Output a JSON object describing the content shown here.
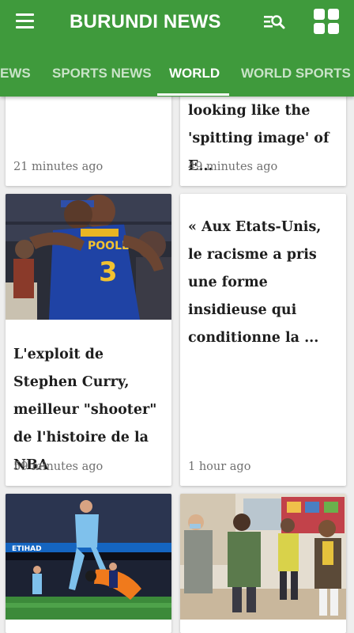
{
  "app": {
    "title": "BURUNDI NEWS",
    "theme_color": "#3f9a3c",
    "icons": {
      "menu": "hamburger-menu-icon",
      "search": "search-list-icon",
      "layout": "grid-view-icon"
    }
  },
  "tabs": [
    {
      "label": "EWS",
      "active": false
    },
    {
      "label": "SPORTS NEWS",
      "active": false
    },
    {
      "label": "WORLD",
      "active": true
    },
    {
      "label": "WORLD SPORTS",
      "active": false
    }
  ],
  "cards": [
    {
      "headline": "",
      "time": "21 minutes ago"
    },
    {
      "headline": "looking like the 'spitting image' of E...",
      "time": "49 minutes ago"
    },
    {
      "headline": "L'exploit de Stephen Curry, meilleur \"shooter\" de l'histoire de la NBA",
      "time": "59 minutes ago",
      "image": "basketball-players-hug-photo"
    },
    {
      "headline": "« Aux Etats-Unis, le racisme a pris une forme insidieuse qui conditionne la ...",
      "time": "1 hour ago"
    },
    {
      "image": "football-match-photo"
    },
    {
      "image": "schoolchildren-in-masks-photo"
    }
  ]
}
